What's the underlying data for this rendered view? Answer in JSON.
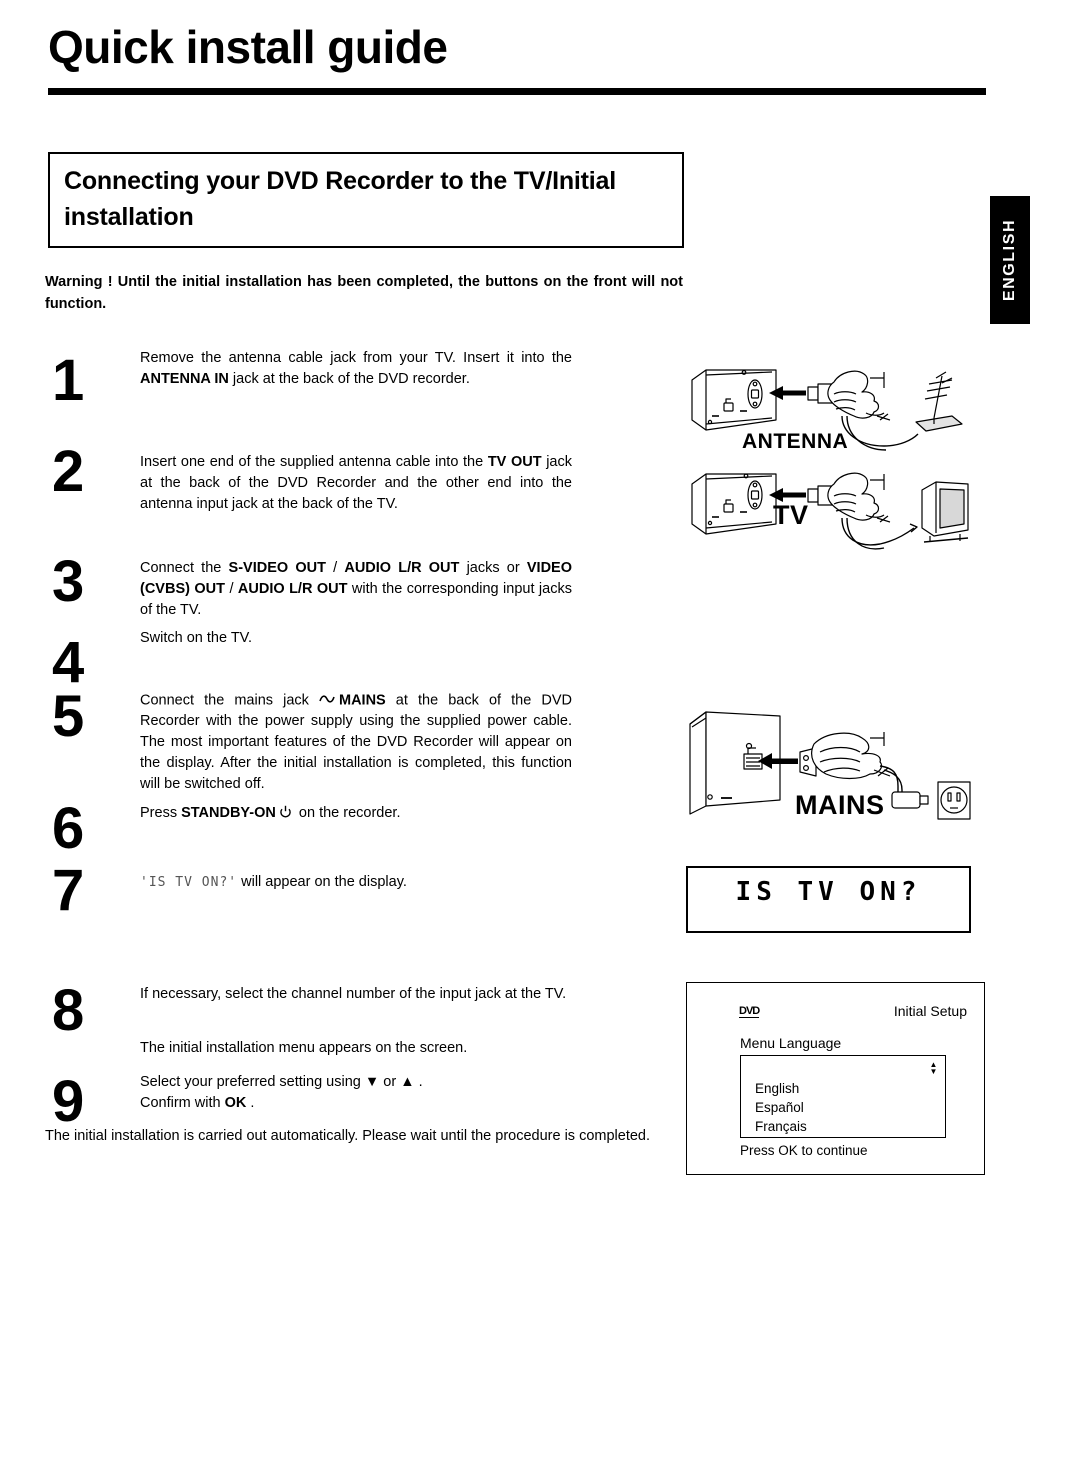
{
  "document": {
    "title": "Quick install guide",
    "section_heading": "Connecting your DVD Recorder to the TV/Initial installation",
    "language_tab": "ENGLISH",
    "warning_line1": "Warning ! Until the initial installation has been completed, the buttons on the front",
    "warning_line2": "will not function.",
    "closing_note": "The initial installation is carried out automatically. Please wait until the procedure is completed."
  },
  "steps": [
    {
      "number": "1",
      "line1_a": "Remove the antenna cable jack from your TV. Insert it into the",
      "bold1": "ANTENNA IN",
      "line2_b": " jack at the back of the DVD recorder."
    },
    {
      "number": "2",
      "line1_a": "Insert one end of the supplied antenna cable into the ",
      "bold1": "TV OUT",
      "line2_b": " jack at the back of the DVD Recorder and the other end into the antenna input jack at the back of the TV."
    },
    {
      "number": "3",
      "pre": "Connect the ",
      "bold1": "S-VIDEO OUT",
      "mid1": " / ",
      "bold2": "AUDIO L/R OUT",
      "mid2": " jacks or ",
      "bold3": "VIDEO (CVBS) OUT",
      "mid3": " / ",
      "bold4": "AUDIO L/R OUT",
      "post": " with the corresponding input jacks of the TV."
    },
    {
      "number": "4",
      "text": "Switch on the TV."
    },
    {
      "number": "5",
      "pre": "Connect the mains jack  ",
      "bold1": "MAINS",
      "post": " at the back of the DVD Recorder with the power supply using the supplied power cable. The most important features of the DVD Recorder will appear on the display. After the initial installation is completed, this function will be switched off."
    },
    {
      "number": "6",
      "pre": "Press  ",
      "bold1": "STANDBY-ON",
      "post": " on the recorder."
    },
    {
      "number": "7",
      "lcd": "'IS TV ON?'",
      "post": " will appear on the display."
    },
    {
      "number": "8",
      "text": "If necessary, select the channel number of the input jack at the TV.",
      "note": "The initial installation menu appears on the screen."
    },
    {
      "number": "9",
      "line1_a": "Select your preferred setting using ",
      "down_arrow": "▼",
      "line1_b": " or ",
      "up_arrow": "▲",
      "line1_c": " .",
      "line2_a": "Confirm with  ",
      "bold_ok": "OK",
      "line2_b": " ."
    }
  ],
  "illustrations": {
    "antenna_label": "ANTENNA",
    "tv_label": "TV",
    "mains_label": "MAINS"
  },
  "lcd_display": {
    "text": "IS TV ON?"
  },
  "osd_menu": {
    "logo": "DVD",
    "title": "Initial Setup",
    "subtitle": "Menu Language",
    "options": [
      "English",
      "Español",
      "Français"
    ],
    "scroll_up": "▲",
    "scroll_down": "▼",
    "footer": "Press OK to continue"
  },
  "colors": {
    "ink": "#000000",
    "paper": "#ffffff"
  }
}
